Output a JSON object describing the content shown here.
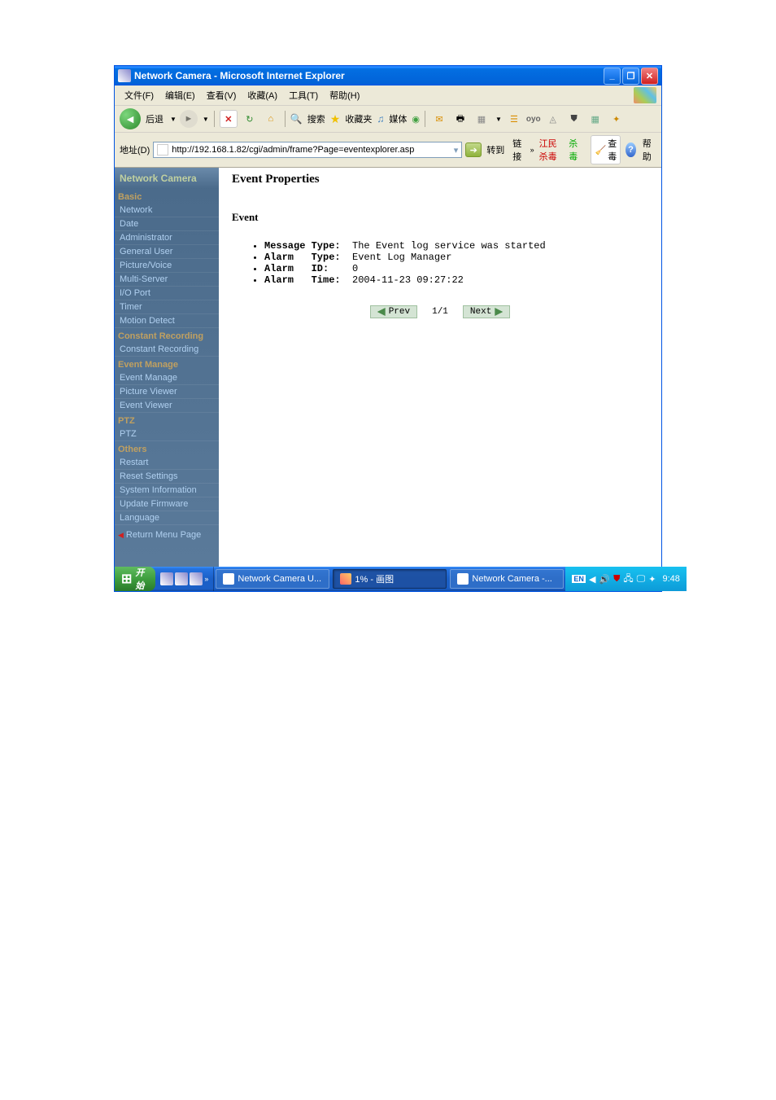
{
  "window": {
    "title": "Network Camera - Microsoft Internet Explorer"
  },
  "menubar": {
    "file": "文件(F)",
    "edit": "编辑(E)",
    "view": "查看(V)",
    "favorites": "收藏(A)",
    "tools": "工具(T)",
    "help": "帮助(H)"
  },
  "toolbar": {
    "back": "后退",
    "search": "搜索",
    "favorites": "收藏夹",
    "media": "媒体"
  },
  "addressbar": {
    "label": "地址(D)",
    "url": "http://192.168.1.82/cgi/admin/frame?Page=eventexplorer.asp",
    "go": "转到",
    "links_label": "链接",
    "link1": "江民杀毒",
    "link2": "杀毒",
    "sweep": "查毒",
    "help": "帮助"
  },
  "sidebar": {
    "title": "Network Camera",
    "sections": [
      {
        "header": "Basic",
        "items": [
          "Network",
          "Date",
          "Administrator",
          "General User",
          "Picture/Voice",
          "Multi-Server",
          "I/O Port",
          "Timer",
          "Motion Detect"
        ]
      },
      {
        "header": "Constant Recording",
        "items": [
          "Constant Recording"
        ]
      },
      {
        "header": "Event Manage",
        "items": [
          "Event Manage",
          "Picture Viewer",
          "Event Viewer"
        ]
      },
      {
        "header": "PTZ",
        "items": [
          "PTZ"
        ]
      },
      {
        "header": "Others",
        "items": [
          "Restart",
          "Reset Settings",
          "System Information",
          "Update Firmware",
          "Language"
        ]
      }
    ],
    "return": "Return Menu Page"
  },
  "main": {
    "title": "Event Properties",
    "subtitle": "Event",
    "rows": [
      {
        "label": "Message Type:",
        "value": "The Event log service was started"
      },
      {
        "label": "Alarm   Type:",
        "value": "Event Log Manager"
      },
      {
        "label": "Alarm   ID:",
        "value": "0"
      },
      {
        "label": "Alarm   Time:",
        "value": "2004-11-23 09:27:22"
      }
    ],
    "pager": {
      "prev": "Prev",
      "count": "1/1",
      "next": "Next"
    }
  },
  "taskbar": {
    "start": "开始",
    "tasks": [
      {
        "label": "Network Camera U...",
        "active": false
      },
      {
        "label": "1% - 画图",
        "active": true
      },
      {
        "label": "Network Camera -...",
        "active": false
      }
    ],
    "clock": "9:48"
  }
}
